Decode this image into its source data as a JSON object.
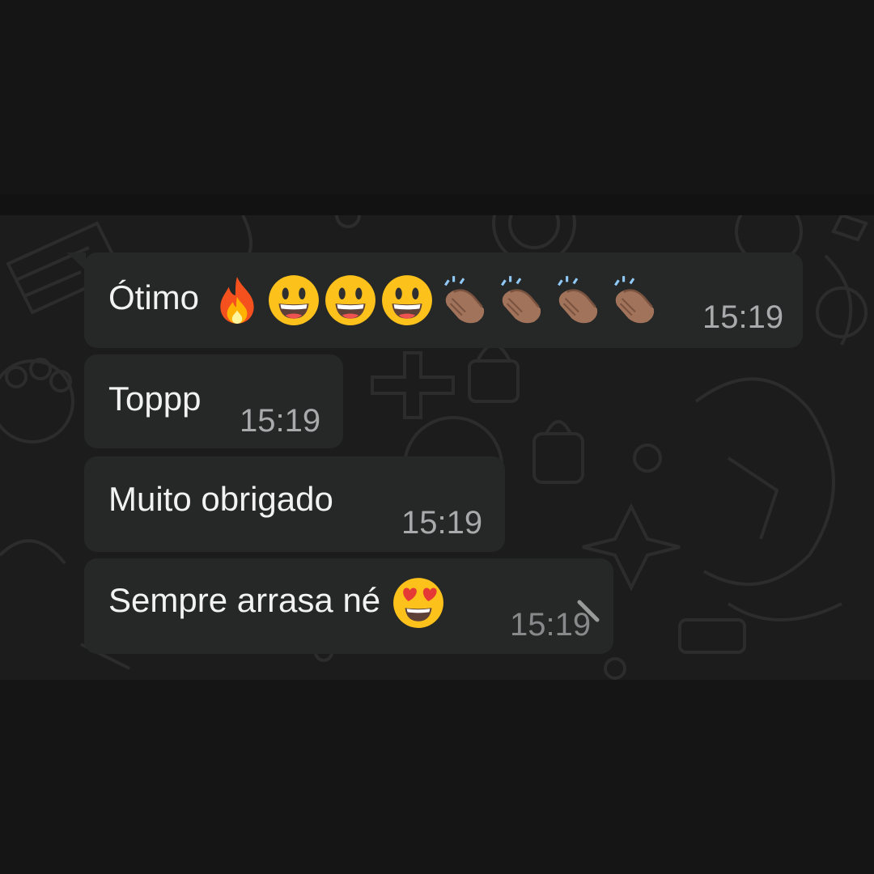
{
  "messages": [
    {
      "text": "Ótimo",
      "emojis": [
        "fire-icon",
        "grinning-face-icon",
        "grinning-face-icon",
        "grinning-face-icon",
        "clapping-hands-icon",
        "clapping-hands-icon",
        "clapping-hands-icon",
        "clapping-hands-icon"
      ],
      "time": "15:19"
    },
    {
      "text": "Toppp",
      "emojis": [],
      "time": "15:19"
    },
    {
      "text": "Muito obrigado",
      "emojis": [],
      "time": "15:19"
    },
    {
      "text": "Sempre arrasa né",
      "emojis": [
        "heart-eyes-face-icon"
      ],
      "time": "15:19"
    }
  ],
  "colors": {
    "background": "#151515",
    "chat_background": "#1c1c1c",
    "bubble": "#262727",
    "text": "#f2f2f2",
    "timestamp": "#a8aaab"
  }
}
